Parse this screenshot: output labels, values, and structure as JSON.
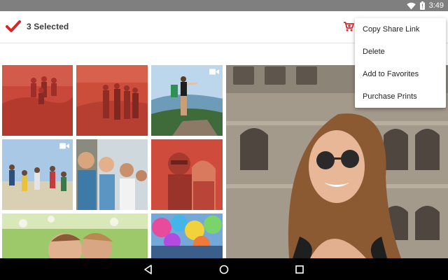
{
  "status_bar": {
    "time": "3:49",
    "icons": [
      "wifi-icon",
      "battery-icon"
    ]
  },
  "app_bar": {
    "selection_title": "3 Selected",
    "icons": [
      "check-icon",
      "cart-icon"
    ]
  },
  "overflow_menu": {
    "items": [
      {
        "label": "Copy Share Link"
      },
      {
        "label": "Delete"
      },
      {
        "label": "Add to Favorites"
      },
      {
        "label": "Purchase Prints"
      }
    ]
  },
  "photo_grid": {
    "tiles": [
      {
        "name": "photo-friends-on-rocks",
        "selected": true,
        "video": false
      },
      {
        "name": "photo-group-on-hill",
        "selected": true,
        "video": false
      },
      {
        "name": "photo-hikers-at-viewpoint",
        "selected": false,
        "video": true
      },
      {
        "name": "photo-friends-jumping",
        "selected": false,
        "video": true
      },
      {
        "name": "photo-friends-selfie",
        "selected": false,
        "video": false
      },
      {
        "name": "photo-couple-selfie",
        "selected": true,
        "video": false
      },
      {
        "name": "photo-kids-in-meadow",
        "selected": false,
        "video": false
      },
      {
        "name": "photo-color-festival",
        "selected": false,
        "video": false
      },
      {
        "name": "photo-woman-colosseum",
        "selected": false,
        "video": false
      }
    ]
  },
  "nav_bar": {
    "buttons": [
      "back-icon",
      "home-icon",
      "recents-icon"
    ]
  },
  "colors": {
    "accent_red": "#d9262b",
    "selection_tint": "#d9432d",
    "status_bar": "#7f7f7f",
    "nav_bar": "#000000"
  }
}
